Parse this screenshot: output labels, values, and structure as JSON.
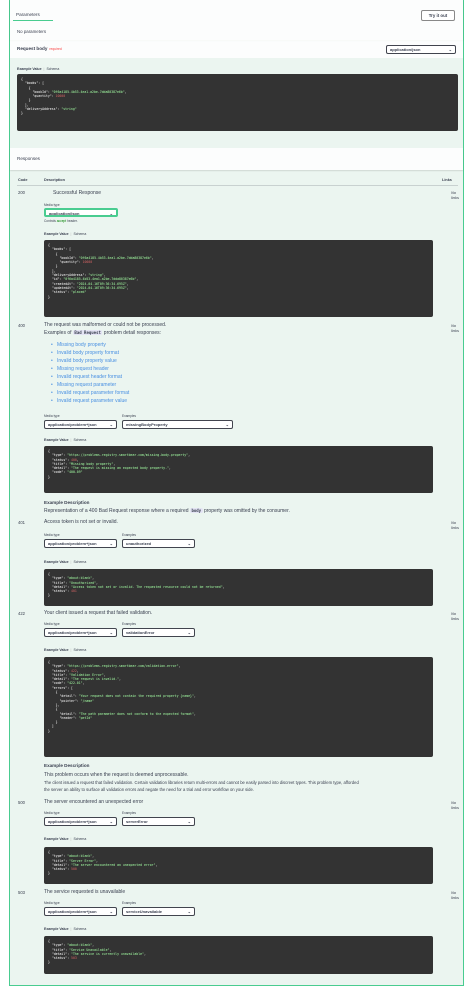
{
  "parameters": {
    "tab_label": "Parameters",
    "try_label": "Try it out",
    "no_params": "No parameters",
    "request_body_label": "Request body",
    "required_label": "required",
    "content_type": "application/json",
    "example_value_label": "Example Value",
    "schema_label": "Schema",
    "code": "{\n  \"books\": [\n    {\n      \"bookId\": \"0f6a4185-4b53-4ea1-a2be-7dda80387e6b\",\n      \"quantity\": 10000\n    }\n  ],\n  \"deliveryAddress\": \"string\"\n}"
  },
  "responses": {
    "title": "Responses",
    "col_code": "Code",
    "col_description": "Description",
    "col_links": "Links",
    "no_links": "No links",
    "media_type_label": "Media type",
    "examples_label": "Examples",
    "controls_text": "Controls",
    "controls_ok": "accept",
    "controls_tail": "header.",
    "example_description_label": "Example Description",
    "r200": {
      "code": "200",
      "desc": "Successful Response",
      "media": "application/json",
      "code_block": "{\n  \"books\": [\n    {\n      \"bookId\": \"0f6a4185-4b53-4ea1-a2be-7dda80387e6b\",\n      \"quantity\": 10000\n    }\n  ],\n  \"deliveryAddress\": \"string\",\n  \"id\": \"0f6a4185-4b53-4ea1-a2be-7dda80387e6b\",\n  \"createdAt\": \"2024-04-16T09:36:34.695Z\",\n  \"updatedAt\": \"2024-04-16T09:36:34.695Z\",\n  \"status\": \"placed\"\n}"
    },
    "r400": {
      "code": "400",
      "desc": "The request was malformed or could not be processed.",
      "examples_prefix": "Examples of",
      "examples_tag": "Bad Request",
      "examples_suffix": "problem detail responses:",
      "links": [
        "Missing body property",
        "Invalid body property format",
        "Invalid body property value",
        "Missing request header",
        "Invalid request header format",
        "Missing request parameter",
        "Invalid request parameter format",
        "Invalid request parameter value"
      ],
      "media": "application/problem+json",
      "example": "missingBodyProperty",
      "code_block": "{\n  \"type\": \"https://problems-registry.smartbear.com/missing-body-property\",\n  \"status\": 400,\n  \"title\": \"Missing body property\",\n  \"detail\": \"The request is missing an expected body property.\",\n  \"code\": \"400-09\"\n}",
      "ex_desc_pre": "Representation of a 400 Bad Request response where a required",
      "ex_desc_tag": "body",
      "ex_desc_post": "property was omitted by the consumer."
    },
    "r401": {
      "code": "401",
      "desc": "Access token is not set or invalid.",
      "media": "application/problem+json",
      "example": "unauthorized",
      "code_block": "{\n  \"type\": \"about:blank\",\n  \"title\": \"Unauthorized\",\n  \"detail\": \"Access token not set or invalid. The requested resource could not be returned\",\n  \"status\": 401\n}"
    },
    "r422": {
      "code": "422",
      "desc": "Your client issued a request that failed validation.",
      "media": "application/problem+json",
      "example": "validationError",
      "code_block": "{\n  \"type\": \"https://problems-registry.smartbear.com/validation-error\",\n  \"status\": 422,\n  \"title\": \"Validation Error\",\n  \"detail\": \"The request is invalid.\",\n  \"code\": \"422-01\",\n  \"errors\": [\n    {\n      \"detail\": \"Your request does not contain the required property {name}\",\n      \"pointer\": \"/name\"\n    },\n    {\n      \"detail\": \"The path parameter does not conform to the expected format\",\n      \"header\": \"petId\"\n    }\n  ]\n}",
      "ex_desc_1": "This problem occurs when the request is deemed unprocessable.",
      "ex_desc_2": "The client issued a request that failed validation. Certain validation libraries return multi-errors and cannot be easily parsed into discreet types. This problem type, afforded",
      "ex_desc_3": "the server an ability to surface all validation errors and negate the need for a trial and error workflow on your side."
    },
    "r500": {
      "code": "500",
      "desc": "The server encountered an unexpected error",
      "media": "application/problem+json",
      "example": "serverError",
      "code_block": "{\n  \"type\": \"about:blank\",\n  \"title\": \"Server Error\",\n  \"detail\": \"The server encountered an unexpected error\",\n  \"status\": 500\n}"
    },
    "r503": {
      "code": "503",
      "desc": "The service requested is unavailable",
      "media": "application/problem+json",
      "example": "serviceUnavailable",
      "code_block": "{\n  \"type\": \"about:blank\",\n  \"title\": \"Service Unavailable\",\n  \"detail\": \"The service is currently unavailable\",\n  \"status\": 503\n}"
    }
  },
  "colors": {
    "accent": "#49cc90",
    "code_bg": "#333333",
    "link": "#4990e2"
  }
}
